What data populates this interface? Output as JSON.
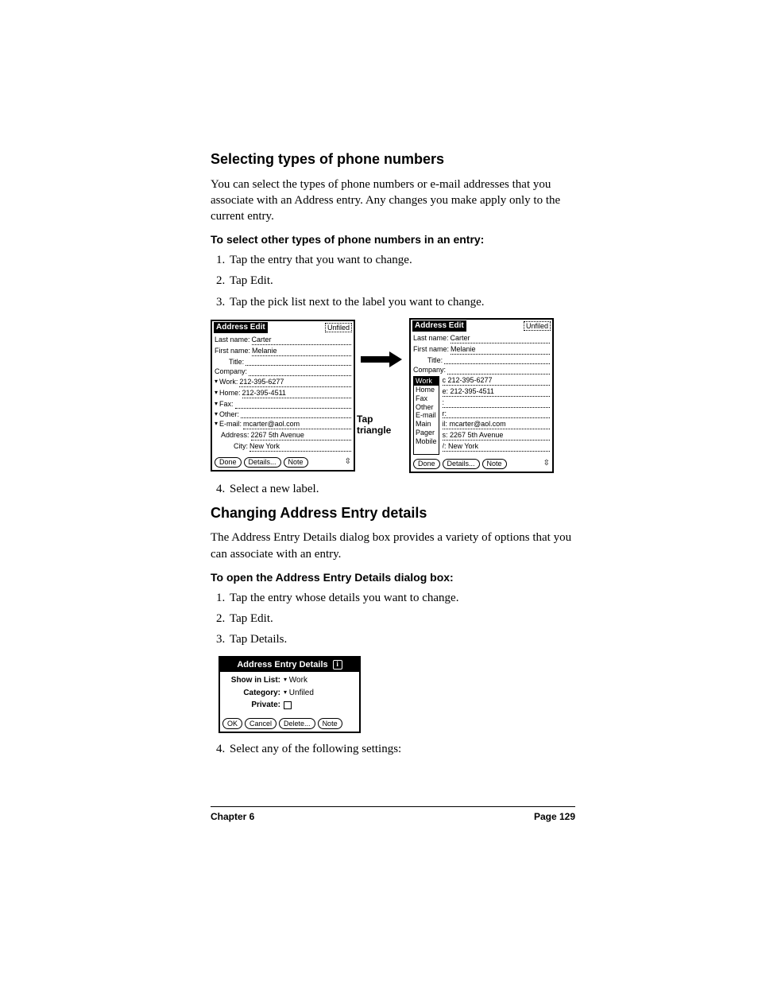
{
  "section1": {
    "title": "Selecting types of phone numbers",
    "intro": "You can select the types of phone numbers or e-mail addresses that you associate with an Address entry. Any changes you make apply only to the current entry.",
    "subhead": "To select other types of phone numbers in an entry:",
    "steps": [
      "Tap the entry that you want to change.",
      "Tap Edit.",
      "Tap the pick list next to the label you want to change."
    ],
    "step4": "Select a new label."
  },
  "fig": {
    "left": {
      "title": "Address Edit",
      "category": "Unfiled",
      "fields": {
        "lastname_label": "Last name:",
        "lastname_val": "Carter",
        "firstname_label": "First name:",
        "firstname_val": "Melanie",
        "title_label": "Title:",
        "company_label": "Company:",
        "work_label": "Work:",
        "work_val": "212-395-6277",
        "home_label": "Home:",
        "home_val": "212-395-4511",
        "fax_label": "Fax:",
        "other_label": "Other:",
        "email_label": "E-mail:",
        "email_val": "mcarter@aol.com",
        "addr_label": "Address:",
        "addr_val": "2267 5th Avenue",
        "city_label": "City:",
        "city_val": "New York"
      },
      "buttons": {
        "done": "Done",
        "details": "Details...",
        "note": "Note"
      }
    },
    "caption": "Tap triangle",
    "right": {
      "title": "Address Edit",
      "category": "Unfiled",
      "fields": {
        "lastname_label": "Last name:",
        "lastname_val": "Carter",
        "firstname_label": "First name:",
        "firstname_val": "Melanie",
        "title_label": "Title:",
        "company_label": "Company:",
        "work_val": "c 212-395-6277",
        "home_val": "e: 212-395-4511",
        "fax_val": ":",
        "other_val": "r:",
        "email_val": "il: mcarter@aol.com",
        "main_val": "s: 2267 5th Avenue",
        "pager_val": "/: New York",
        "mobile_val": ""
      },
      "picklist": [
        "Work",
        "Home",
        "Fax",
        "Other",
        "E-mail",
        "Main",
        "Pager",
        "Mobile"
      ],
      "buttons": {
        "done": "Done",
        "details": "Details...",
        "note": "Note"
      }
    }
  },
  "section2": {
    "title": "Changing Address Entry details",
    "intro": "The Address Entry Details dialog box provides a variety of options that you can associate with an entry.",
    "subhead": "To open the Address Entry Details dialog box:",
    "steps": [
      "Tap the entry whose details you want to change.",
      "Tap Edit.",
      "Tap Details."
    ],
    "step4": "Select any of the following settings:"
  },
  "details": {
    "title": "Address Entry Details",
    "showinlist_label": "Show in List:",
    "showinlist_val": "Work",
    "category_label": "Category:",
    "category_val": "Unfiled",
    "private_label": "Private:",
    "buttons": {
      "ok": "OK",
      "cancel": "Cancel",
      "delete": "Delete...",
      "note": "Note"
    }
  },
  "footer": {
    "left": "Chapter 6",
    "right": "Page 129"
  }
}
